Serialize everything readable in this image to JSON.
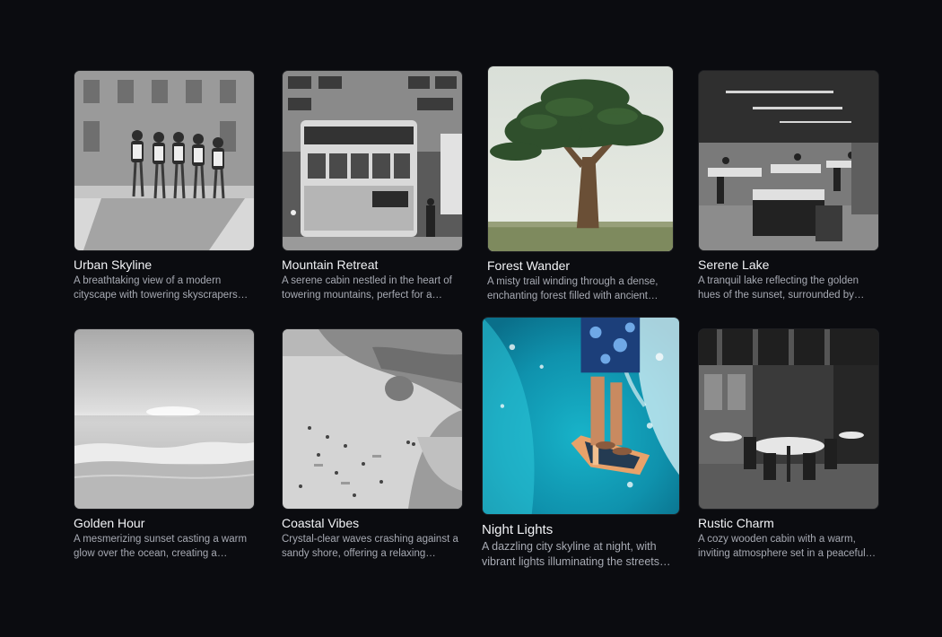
{
  "gallery": {
    "cards": [
      {
        "title": "Urban Skyline",
        "description": "A breathtaking view of a modern cityscape with towering skyscrapers and bustling streets below."
      },
      {
        "title": "Mountain Retreat",
        "description": "A serene cabin nestled in the heart of towering mountains, perfect for a peaceful getaway."
      },
      {
        "title": "Forest Wander",
        "description": "A misty trail winding through a dense, enchanting forest filled with ancient trees."
      },
      {
        "title": "Serene Lake",
        "description": "A tranquil lake reflecting the golden hues of the sunset, surrounded by calm nature."
      },
      {
        "title": "Golden Hour",
        "description": "A mesmerizing sunset casting a warm glow over the ocean, creating a peaceful scene."
      },
      {
        "title": "Coastal Vibes",
        "description": "Crystal-clear waves crashing against a sandy shore, offering a relaxing seaside escape."
      },
      {
        "title": "Night Lights",
        "description": "A dazzling city skyline at night, with vibrant lights illuminating the streets below."
      },
      {
        "title": "Rustic Charm",
        "description": "A cozy wooden cabin with a warm, inviting atmosphere set in a peaceful countryside."
      }
    ]
  }
}
